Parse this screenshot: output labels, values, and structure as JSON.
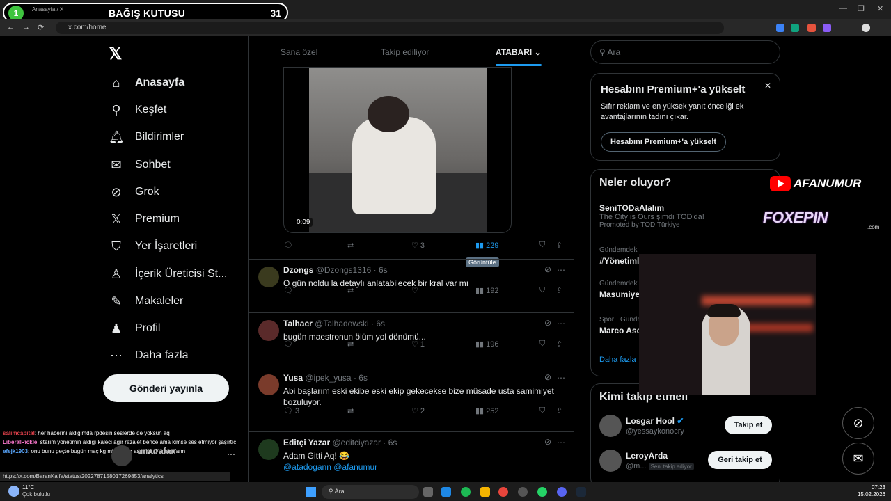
{
  "browser": {
    "tab_title": "Anasayfa / X",
    "url": "x.com/home",
    "nav": {
      "back": "←",
      "forward": "→",
      "reload": "⟳"
    }
  },
  "overlay": {
    "donation_number": "1",
    "donation_title": "BAĞIŞ KUTUSU",
    "donation_count": "31",
    "brand1": "AFANUMUR",
    "brand2": "FOXEPIN",
    "brand2_sub": ".com"
  },
  "sidebar": {
    "logo": "𝕏",
    "items": [
      {
        "label": "Anasayfa",
        "icon": "home-icon",
        "glyph": "⌂"
      },
      {
        "label": "Keşfet",
        "icon": "search-icon",
        "glyph": "⚲"
      },
      {
        "label": "Bildirimler",
        "icon": "bell-icon",
        "glyph": "🔔︎"
      },
      {
        "label": "Sohbet",
        "icon": "mail-icon",
        "glyph": "✉"
      },
      {
        "label": "Grok",
        "icon": "grok-icon",
        "glyph": "⊘"
      },
      {
        "label": "Premium",
        "icon": "x-icon",
        "glyph": "𝕏"
      },
      {
        "label": "Yer İşaretleri",
        "icon": "bookmark-icon",
        "glyph": "⛉"
      },
      {
        "label": "İçerik Üreticisi St...",
        "icon": "creator-icon",
        "glyph": "♙"
      },
      {
        "label": "Makaleler",
        "icon": "article-icon",
        "glyph": "✎"
      },
      {
        "label": "Profil",
        "icon": "profile-icon",
        "glyph": "♟"
      },
      {
        "label": "Daha fazla",
        "icon": "more-icon",
        "glyph": "⋯"
      }
    ],
    "post_button": "Gönderi yayınla",
    "account_name": "umurafan"
  },
  "feed": {
    "tabs": [
      "Sana özel",
      "Takip ediliyor",
      "ATABARI"
    ],
    "video_time": "0:09",
    "video_actions": {
      "likes": "3",
      "views": "229"
    },
    "tooltip": "Görüntüle",
    "tweets": [
      {
        "name": "Dzongs",
        "handle": "@Dzongs1316",
        "time": "· 6s",
        "text": "O gün noldu la detaylı anlatabilecek bir kral var mı",
        "replies": "",
        "reposts": "",
        "likes": "",
        "views": "192",
        "avatar_color": "#3a3a1e"
      },
      {
        "name": "Talhacr",
        "handle": "@Talhadowski",
        "time": "· 6s",
        "text": "bugün maestronun ölüm yol dönümü...",
        "replies": "",
        "reposts": "",
        "likes": "1",
        "views": "196",
        "avatar_color": "#5a2a2a"
      },
      {
        "name": "Yusa",
        "handle": "@ipek_yusa",
        "time": "· 6s",
        "text": "Abi başlarım eski ekibe eski ekip gekecekse bize müsade usta samimiyet bozuluyor.",
        "replies": "3",
        "reposts": "",
        "likes": "2",
        "views": "252",
        "avatar_color": "#7a3b2b"
      },
      {
        "name": "Editçi Yazar",
        "handle": "@editciyazar",
        "time": "· 6s",
        "text": "Adam Gitti Aq! 😂",
        "link": "@atadogann @afanumur",
        "avatar_color": "#1e3a1e"
      }
    ]
  },
  "right": {
    "search_placeholder": "Ara",
    "premium": {
      "title": "Hesabını Premium+'a yükselt",
      "body": "Sıfır reklam ve en yüksek yanıt önceliği ek avantajlarının tadını çıkar.",
      "button": "Hesabını Premium+'a yükselt",
      "close": "✕"
    },
    "trends_title": "Neler oluyor?",
    "trends": [
      {
        "meta": "SeniTODaAlalım",
        "title": "The City is Ours şimdi TOD'da!",
        "extra": "Promoted by TOD Türkiye"
      },
      {
        "meta": "Gündemdek",
        "title": "#Yönetiml"
      },
      {
        "meta": "Gündemdek",
        "title": "Masumiye"
      },
      {
        "meta": "Spor · Günde",
        "title": "Marco Ase"
      }
    ],
    "more_link": "Daha fazla",
    "follow_title": "Kimi takip etmeli",
    "follow": [
      {
        "name": "Losgar Hool",
        "handle": "@yessaykonocry",
        "button": "Takip et"
      },
      {
        "name": "LeroyArda",
        "handle": "@m...",
        "badge": "Seni takip ediyor",
        "button": "Geri takip et"
      }
    ]
  },
  "chat": [
    {
      "user": "salimcapital",
      "msg": ": her haberini aldigimda rpdesin seslerde de yoksun aq",
      "color": "#e0404a"
    },
    {
      "user": "LiberalPickle",
      "msg": ": starım yönetimin aldığı kaleci ağır rezalet bence ama kimse ses etmiyor şaşırtıcı",
      "color": "#ff7ad1"
    },
    {
      "user": "efejk1903",
      "msg": ": onu bunu geçte bugün maç kg mi oranlar aşırı iyi @umurafann",
      "color": "#5aa8ff"
    }
  ],
  "status_url": "https://x.com/BaranKalfa/status/2022787158017269853/analytics",
  "taskbar": {
    "weather_temp": "11°C",
    "weather_desc": "Çok bulutlu",
    "search": "Ara",
    "time": "07:23",
    "date": "15.02.2026"
  },
  "colors": {
    "accent": "#1d9bf0",
    "border": "#2f3336",
    "muted": "#71767b"
  }
}
